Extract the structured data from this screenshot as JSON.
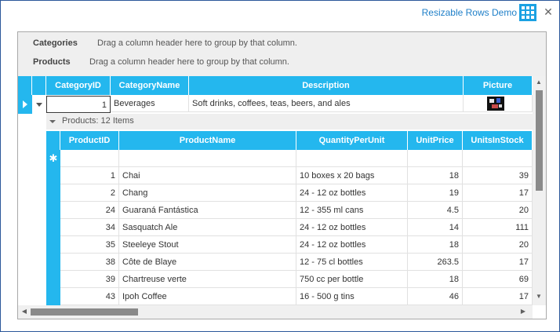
{
  "window": {
    "title": "Resizable Rows Demo"
  },
  "group_panel": [
    {
      "label": "Categories",
      "hint": "Drag a column header here to group by that column."
    },
    {
      "label": "Products",
      "hint": "Drag a column header here to group by that column."
    }
  ],
  "category_columns": [
    "CategoryID",
    "CategoryName",
    "Description",
    "Picture"
  ],
  "category_row": {
    "id": "1",
    "name": "Beverages",
    "description": "Soft drinks, coffees, teas, beers, and ales"
  },
  "products_header": "Products: 12 Items",
  "product_columns": [
    "ProductID",
    "ProductName",
    "QuantityPerUnit",
    "UnitPrice",
    "UnitsInStock"
  ],
  "new_row_symbol": "✱",
  "products": [
    [
      "1",
      "Chai",
      "10 boxes x 20 bags",
      "18",
      "39"
    ],
    [
      "2",
      "Chang",
      "24 - 12 oz bottles",
      "19",
      "17"
    ],
    [
      "24",
      "Guaraná Fantástica",
      "12 - 355 ml cans",
      "4.5",
      "20"
    ],
    [
      "34",
      "Sasquatch Ale",
      "24 - 12 oz bottles",
      "14",
      "111"
    ],
    [
      "35",
      "Steeleye Stout",
      "24 - 12 oz bottles",
      "18",
      "20"
    ],
    [
      "38",
      "Côte de Blaye",
      "12 - 75 cl bottles",
      "263.5",
      "17"
    ],
    [
      "39",
      "Chartreuse verte",
      "750 cc per bottle",
      "18",
      "69"
    ],
    [
      "43",
      "Ipoh Coffee",
      "16 - 500 g tins",
      "46",
      "17"
    ]
  ],
  "colors": {
    "accent": "#24b7ee",
    "title": "#1e7fc8",
    "group_panel": "#efefef"
  },
  "icons": [
    "app-grid-icon",
    "close-icon",
    "row-indicator-icon",
    "expand-chevron-icon",
    "collapse-chevron-icon",
    "scroll-up-icon",
    "scroll-down-icon",
    "scroll-left-icon",
    "scroll-right-icon"
  ]
}
